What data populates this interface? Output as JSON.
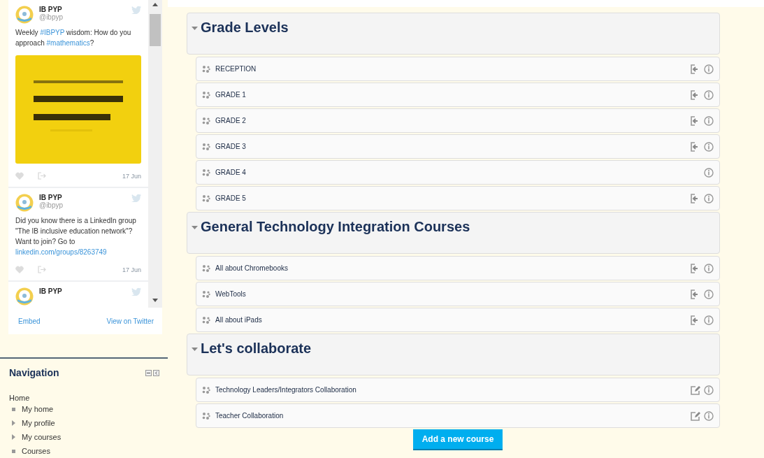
{
  "tweets": [
    {
      "name": "IB PYP",
      "handle": "@ibpyp",
      "parts": [
        {
          "text": "Weekly ",
          "link": false
        },
        {
          "text": "#IBPYP",
          "link": true
        },
        {
          "text": " wisdom: How do you approach ",
          "link": false
        },
        {
          "text": "#mathematics",
          "link": true
        },
        {
          "text": "?",
          "link": false
        }
      ],
      "media": {
        "kind": "picture"
      },
      "date": "17 Jun"
    },
    {
      "name": "IB PYP",
      "handle": "@ibpyp",
      "parts": [
        {
          "text": "Did you know there is a LinkedIn group \"The IB inclusive education network\"? Want to join? Go to ",
          "link": false
        },
        {
          "text": "linkedin.com/groups/8263749",
          "link": true
        }
      ],
      "date": "17 Jun"
    },
    {
      "name": "IB PYP"
    }
  ],
  "widget_footer": {
    "embed": "Embed",
    "view": "View on Twitter"
  },
  "navigation": {
    "title": "Navigation",
    "home": "Home",
    "items": [
      {
        "label": "My home",
        "kind": "leaf"
      },
      {
        "label": "My profile",
        "kind": "branch"
      },
      {
        "label": "My courses",
        "kind": "branch"
      },
      {
        "label": "Courses",
        "kind": "leaf"
      }
    ]
  },
  "categories": [
    {
      "title": "Grade Levels",
      "courses": [
        {
          "name": "RECEPTION",
          "kind": "enrol"
        },
        {
          "name": "GRADE 1",
          "kind": "enrol"
        },
        {
          "name": "GRADE 2",
          "kind": "enrol"
        },
        {
          "name": "GRADE 3",
          "kind": "enrol"
        },
        {
          "name": "GRADE 4",
          "kind": "info"
        },
        {
          "name": "GRADE 5",
          "kind": "enrol"
        }
      ]
    },
    {
      "title": "General Technology Integration Courses",
      "courses": [
        {
          "name": "All about Chromebooks",
          "kind": "enrol"
        },
        {
          "name": "WebTools",
          "kind": "enrol"
        },
        {
          "name": "All about iPads",
          "kind": "enrol"
        }
      ]
    },
    {
      "title": "Let's collaborate",
      "courses": [
        {
          "name": "Technology Leaders/Integrators Collaboration",
          "kind": "edit"
        },
        {
          "name": "Teacher Collaboration",
          "kind": "edit"
        }
      ]
    }
  ],
  "add_button": "Add a new course"
}
